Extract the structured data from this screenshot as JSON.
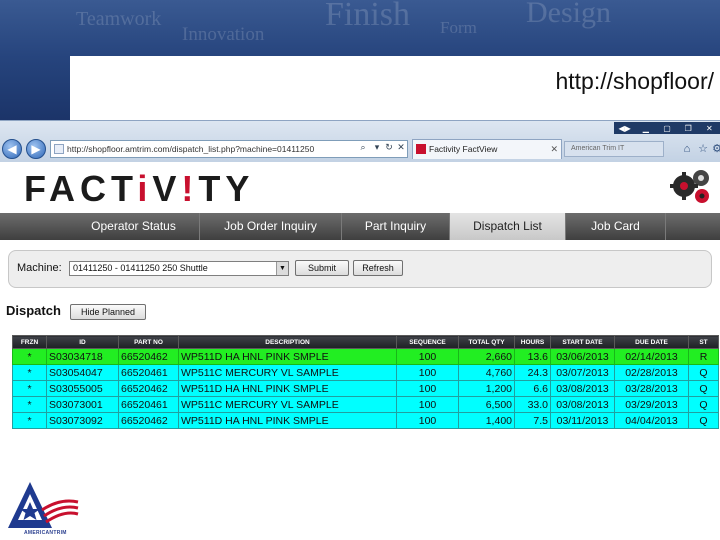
{
  "slide": {
    "watermarks": [
      "Teamwork",
      "Innovation",
      "Finish",
      "Form",
      "Design"
    ],
    "url_title": "http://shopfloor/"
  },
  "browser": {
    "address": "http://shopfloor.amtrim.com/dispatch_list.php?machine=01411250",
    "active_tab": "Factivity FactView",
    "inactive_tab": "American Trim IT"
  },
  "app": {
    "logo": [
      "F",
      "A",
      "C",
      "T",
      "i",
      "V",
      "!",
      "T",
      "Y"
    ],
    "nav": [
      "Operator Status",
      "Job Order Inquiry",
      "Part Inquiry",
      "Dispatch List",
      "Job Card"
    ],
    "active_nav": "Dispatch List"
  },
  "filter": {
    "machine_label": "Machine:",
    "machine_value": "01411250 - 01411250 250 Shuttle",
    "submit_label": "Submit",
    "refresh_label": "Refresh"
  },
  "dispatch": {
    "title": "Dispatch",
    "hide_planned_label": "Hide Planned",
    "columns": [
      "FRZN",
      "ID",
      "PART NO",
      "DESCRIPTION",
      "SEQUENCE",
      "TOTAL QTY",
      "HOURS",
      "START DATE",
      "DUE DATE",
      "ST"
    ],
    "rows": [
      {
        "frzn": "*",
        "id": "S03034718",
        "part_no": "66520462",
        "description": "WP511D HA HNL PINK SMPLE",
        "sequence": "100",
        "total_qty": "2,660",
        "hours": "13.6",
        "start_date": "03/06/2013",
        "due_date": "02/14/2013",
        "st": "R",
        "active": true
      },
      {
        "frzn": "*",
        "id": "S03054047",
        "part_no": "66520461",
        "description": "WP511C MERCURY VL SAMPLE",
        "sequence": "100",
        "total_qty": "4,760",
        "hours": "24.3",
        "start_date": "03/07/2013",
        "due_date": "02/28/2013",
        "st": "Q",
        "active": false
      },
      {
        "frzn": "*",
        "id": "S03055005",
        "part_no": "66520462",
        "description": "WP511D HA HNL PINK SMPLE",
        "sequence": "100",
        "total_qty": "1,200",
        "hours": "6.6",
        "start_date": "03/08/2013",
        "due_date": "03/28/2013",
        "st": "Q",
        "active": false
      },
      {
        "frzn": "*",
        "id": "S03073001",
        "part_no": "66520461",
        "description": "WP511C MERCURY VL SAMPLE",
        "sequence": "100",
        "total_qty": "6,500",
        "hours": "33.0",
        "start_date": "03/08/2013",
        "due_date": "03/29/2013",
        "st": "Q",
        "active": false
      },
      {
        "frzn": "*",
        "id": "S03073092",
        "part_no": "66520462",
        "description": "WP511D HA HNL PINK SMPLE",
        "sequence": "100",
        "total_qty": "1,400",
        "hours": "7.5",
        "start_date": "03/11/2013",
        "due_date": "04/04/2013",
        "st": "Q",
        "active": false
      }
    ]
  },
  "footer": {
    "company_text": "AMERICANTRIM"
  },
  "colors": {
    "banner": "#26447d",
    "row_active": "#22ee22",
    "row_normal": "#00ffff",
    "logo_accent": "#c8102e"
  }
}
